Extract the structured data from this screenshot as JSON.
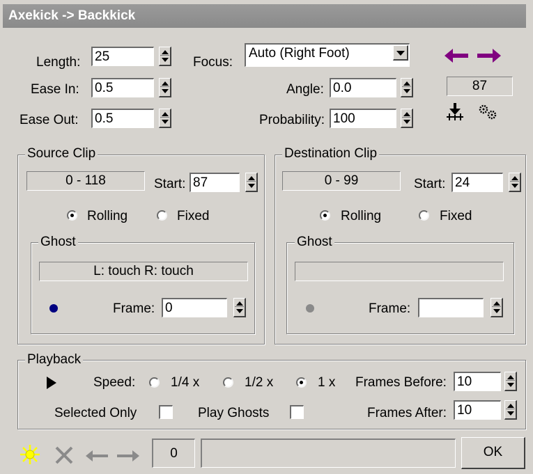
{
  "window": {
    "title": "Axekick -> Backkick"
  },
  "params": {
    "length_label": "Length:",
    "length_value": "25",
    "easein_label": "Ease In:",
    "easein_value": "0.5",
    "easeout_label": "Ease Out:",
    "easeout_value": "0.5",
    "focus_label": "Focus:",
    "focus_value": "Auto (Right Foot)",
    "angle_label": "Angle:",
    "angle_value": "0.0",
    "probability_label": "Probability:",
    "probability_value": "100",
    "frame_readout": "87"
  },
  "source_clip": {
    "title": "Source Clip",
    "range": "0 - 118",
    "start_label": "Start:",
    "start_value": "87",
    "rolling_label": "Rolling",
    "fixed_label": "Fixed",
    "selected_mode": "Rolling",
    "ghost": {
      "title": "Ghost",
      "status": "L: touch  R: touch",
      "frame_label": "Frame:",
      "frame_value": "0",
      "dot_color": "#000080"
    }
  },
  "destination_clip": {
    "title": "Destination Clip",
    "range": "0 - 99",
    "start_label": "Start:",
    "start_value": "24",
    "rolling_label": "Rolling",
    "fixed_label": "Fixed",
    "selected_mode": "Rolling",
    "ghost": {
      "title": "Ghost",
      "status": "",
      "frame_label": "Frame:",
      "frame_value": "",
      "dot_color": "#8a8a8a"
    }
  },
  "playback": {
    "title": "Playback",
    "speed_label": "Speed:",
    "speed_options": [
      "1/4 x",
      "1/2 x",
      "1 x"
    ],
    "selected_speed": "1 x",
    "frames_before_label": "Frames Before:",
    "frames_before_value": "10",
    "frames_after_label": "Frames After:",
    "frames_after_value": "10",
    "selected_only_label": "Selected Only",
    "play_ghosts_label": "Play Ghosts"
  },
  "footer": {
    "counter": "0",
    "status": "",
    "ok_label": "OK"
  },
  "colors": {
    "arrow_purple": "#800080",
    "sun_yellow": "#ffff00",
    "title_bg": "#8a8a8a"
  },
  "icons": [
    "arrow-left-icon",
    "arrow-right-icon",
    "move-down-icon",
    "gears-icon",
    "play-icon",
    "sun-icon",
    "delete-x-icon",
    "back-arrow-icon",
    "forward-arrow-icon"
  ]
}
